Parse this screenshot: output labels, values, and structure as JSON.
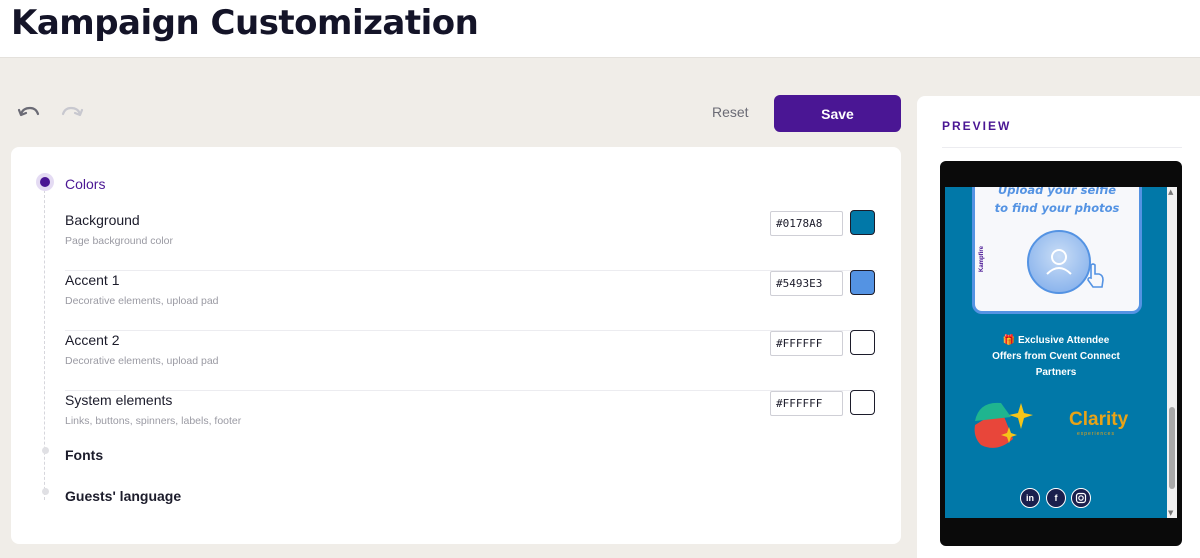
{
  "header": {
    "title": "Kampaign Customization"
  },
  "toolbar": {
    "undo_icon": "undo-icon",
    "redo_icon": "redo-icon",
    "reset_label": "Reset",
    "save_label": "Save"
  },
  "steps": {
    "colors": {
      "label": "Colors",
      "rows": [
        {
          "label": "Background",
          "description": "Page background color",
          "value": "#0178A8",
          "swatch": "#0178a8"
        },
        {
          "label": "Accent 1",
          "description": "Decorative elements, upload pad",
          "value": "#5493E3",
          "swatch": "#5493e3"
        },
        {
          "label": "Accent 2",
          "description": "Decorative elements, upload pad",
          "value": "#FFFFFF",
          "swatch": "#ffffff"
        },
        {
          "label": "System elements",
          "description": "Links, buttons, spinners, labels, footer",
          "value": "#FFFFFF",
          "swatch": "#ffffff"
        }
      ]
    },
    "fonts": {
      "label": "Fonts"
    },
    "language": {
      "label": "Guests' language"
    }
  },
  "preview": {
    "title": "PREVIEW",
    "upload_line1": "Upload your selfie",
    "upload_line2": "to find your photos",
    "brand": "Kampfire",
    "offer_line1": "🎁 Exclusive Attendee",
    "offer_line2": "Offers from Cvent Connect",
    "offer_line3": "Partners",
    "clarity_logo": "Clarity",
    "clarity_sub": "experiences",
    "social": {
      "linkedin": "in",
      "facebook": "f",
      "instagram": "ig"
    }
  },
  "colors": {
    "brand_purple": "#4a1694",
    "page_bg": "#f0ede8"
  }
}
